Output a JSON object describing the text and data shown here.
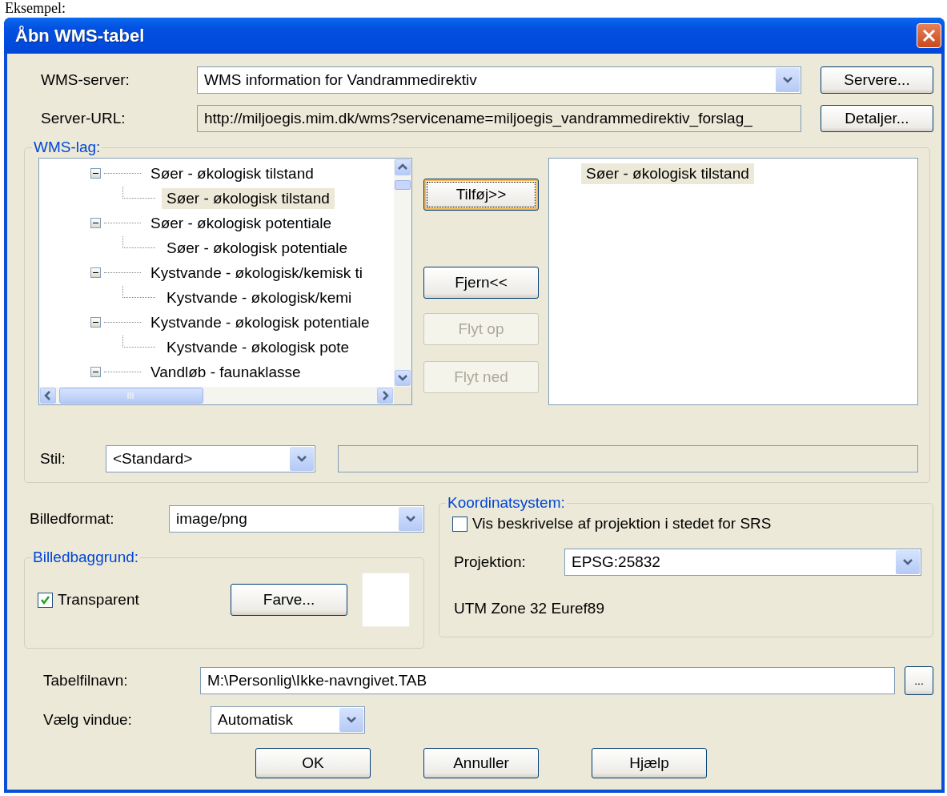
{
  "caption": "Eksempel:",
  "window": {
    "title": "Åbn WMS-tabel"
  },
  "server": {
    "label": "WMS-server:",
    "value": "WMS information for Vandrammedirektiv",
    "button": {
      "label": "Servere..."
    }
  },
  "url": {
    "label": "Server-URL:",
    "value": "http://miljoegis.mim.dk/wms?servicename=miljoegis_vandrammedirektiv_forslag_",
    "button": {
      "label": "Detaljer..."
    }
  },
  "layers": {
    "title": "WMS-lag:",
    "tree": [
      {
        "label": "Søer - økologisk tilstand",
        "expanded": true,
        "selected": false,
        "children": [
          {
            "label": "Søer - økologisk tilstand",
            "selected": true
          }
        ]
      },
      {
        "label": "Søer - økologisk potentiale",
        "expanded": true,
        "selected": false,
        "children": [
          {
            "label": "Søer - økologisk potentiale",
            "selected": false
          }
        ]
      },
      {
        "label": "Kystvande - økologisk/kemisk ti",
        "expanded": true,
        "selected": false,
        "children": [
          {
            "label": "Kystvande - økologisk/kemi",
            "selected": false
          }
        ]
      },
      {
        "label": "Kystvande - økologisk potentiale",
        "expanded": true,
        "selected": false,
        "children": [
          {
            "label": "Kystvande - økologisk pote",
            "selected": false
          }
        ]
      },
      {
        "label": "Vandløb - faunaklasse",
        "expanded": true,
        "selected": false
      }
    ],
    "actions": [
      {
        "label": "Tilføj>>",
        "disabled": false,
        "focused": true
      },
      {
        "label": "Fjern<<",
        "disabled": false,
        "focused": false
      },
      {
        "label": "Flyt op",
        "disabled": true,
        "focused": false
      },
      {
        "label": "Flyt ned",
        "disabled": true,
        "focused": false
      }
    ],
    "chosen": [
      {
        "label": "Søer - økologisk tilstand",
        "selected": true
      }
    ],
    "style": {
      "label": "Stil:",
      "value": "<Standard>"
    }
  },
  "format": {
    "label": "Billedformat:",
    "value": "image/png"
  },
  "background": {
    "title": "Billedbaggrund:",
    "transparent": {
      "label": "Transparent",
      "checked": true
    },
    "button": {
      "label": "Farve..."
    }
  },
  "coords": {
    "title": "Koordinatsystem:",
    "describe": {
      "label": "Vis beskrivelse af projektion i stedet for SRS",
      "checked": false
    },
    "projection": {
      "label": "Projektion:",
      "value": "EPSG:25832"
    },
    "description": "UTM Zone 32 Euref89"
  },
  "table_file": {
    "label": "Tabelfilnavn:",
    "value": "M:\\Personlig\\Ikke-navngivet.TAB",
    "button": "..."
  },
  "target_window": {
    "label": "Vælg vindue:",
    "value": "Automatisk"
  },
  "buttons": [
    {
      "label": "OK"
    },
    {
      "label": "Annuller"
    },
    {
      "label": "Hjælp"
    }
  ]
}
